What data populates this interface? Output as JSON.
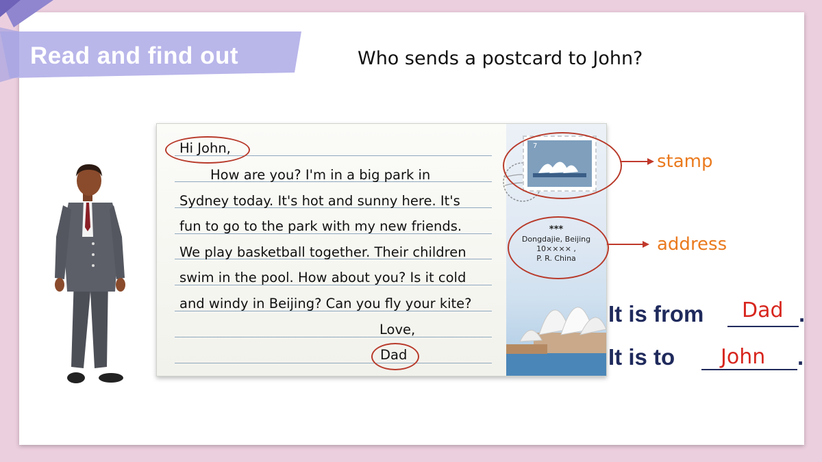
{
  "header": {
    "banner_title": "Read and find out",
    "question": "Who sends a postcard to John?"
  },
  "postcard": {
    "letter_lines": [
      "Hi John,",
      "How are you? I'm in a big park in",
      "Sydney today. It's hot and sunny here. It's",
      "fun to go to the park with my new friends.",
      "We play basketball together. Their children",
      "swim in the pool. How about you? Is it cold",
      "and windy in Beijing? Can you fly your kite?",
      "Love,",
      "Dad"
    ],
    "stamp_value": "7",
    "address": {
      "name": "***",
      "line1": "Dongdajie, Beijing",
      "line2": "10×××× ,",
      "line3": "P. R. China"
    }
  },
  "labels": {
    "stamp": "stamp",
    "address": "address"
  },
  "answers": {
    "from_prefix": "It is from",
    "from_answer": "Dad",
    "to_prefix": "It is to",
    "to_answer": "John",
    "period": "."
  },
  "colors": {
    "banner": "#b9b6ea",
    "label_orange": "#ea7a1e",
    "answer_red": "#d7261e",
    "sentence_navy": "#1f2a5c",
    "oval_red": "#b83a2a"
  }
}
